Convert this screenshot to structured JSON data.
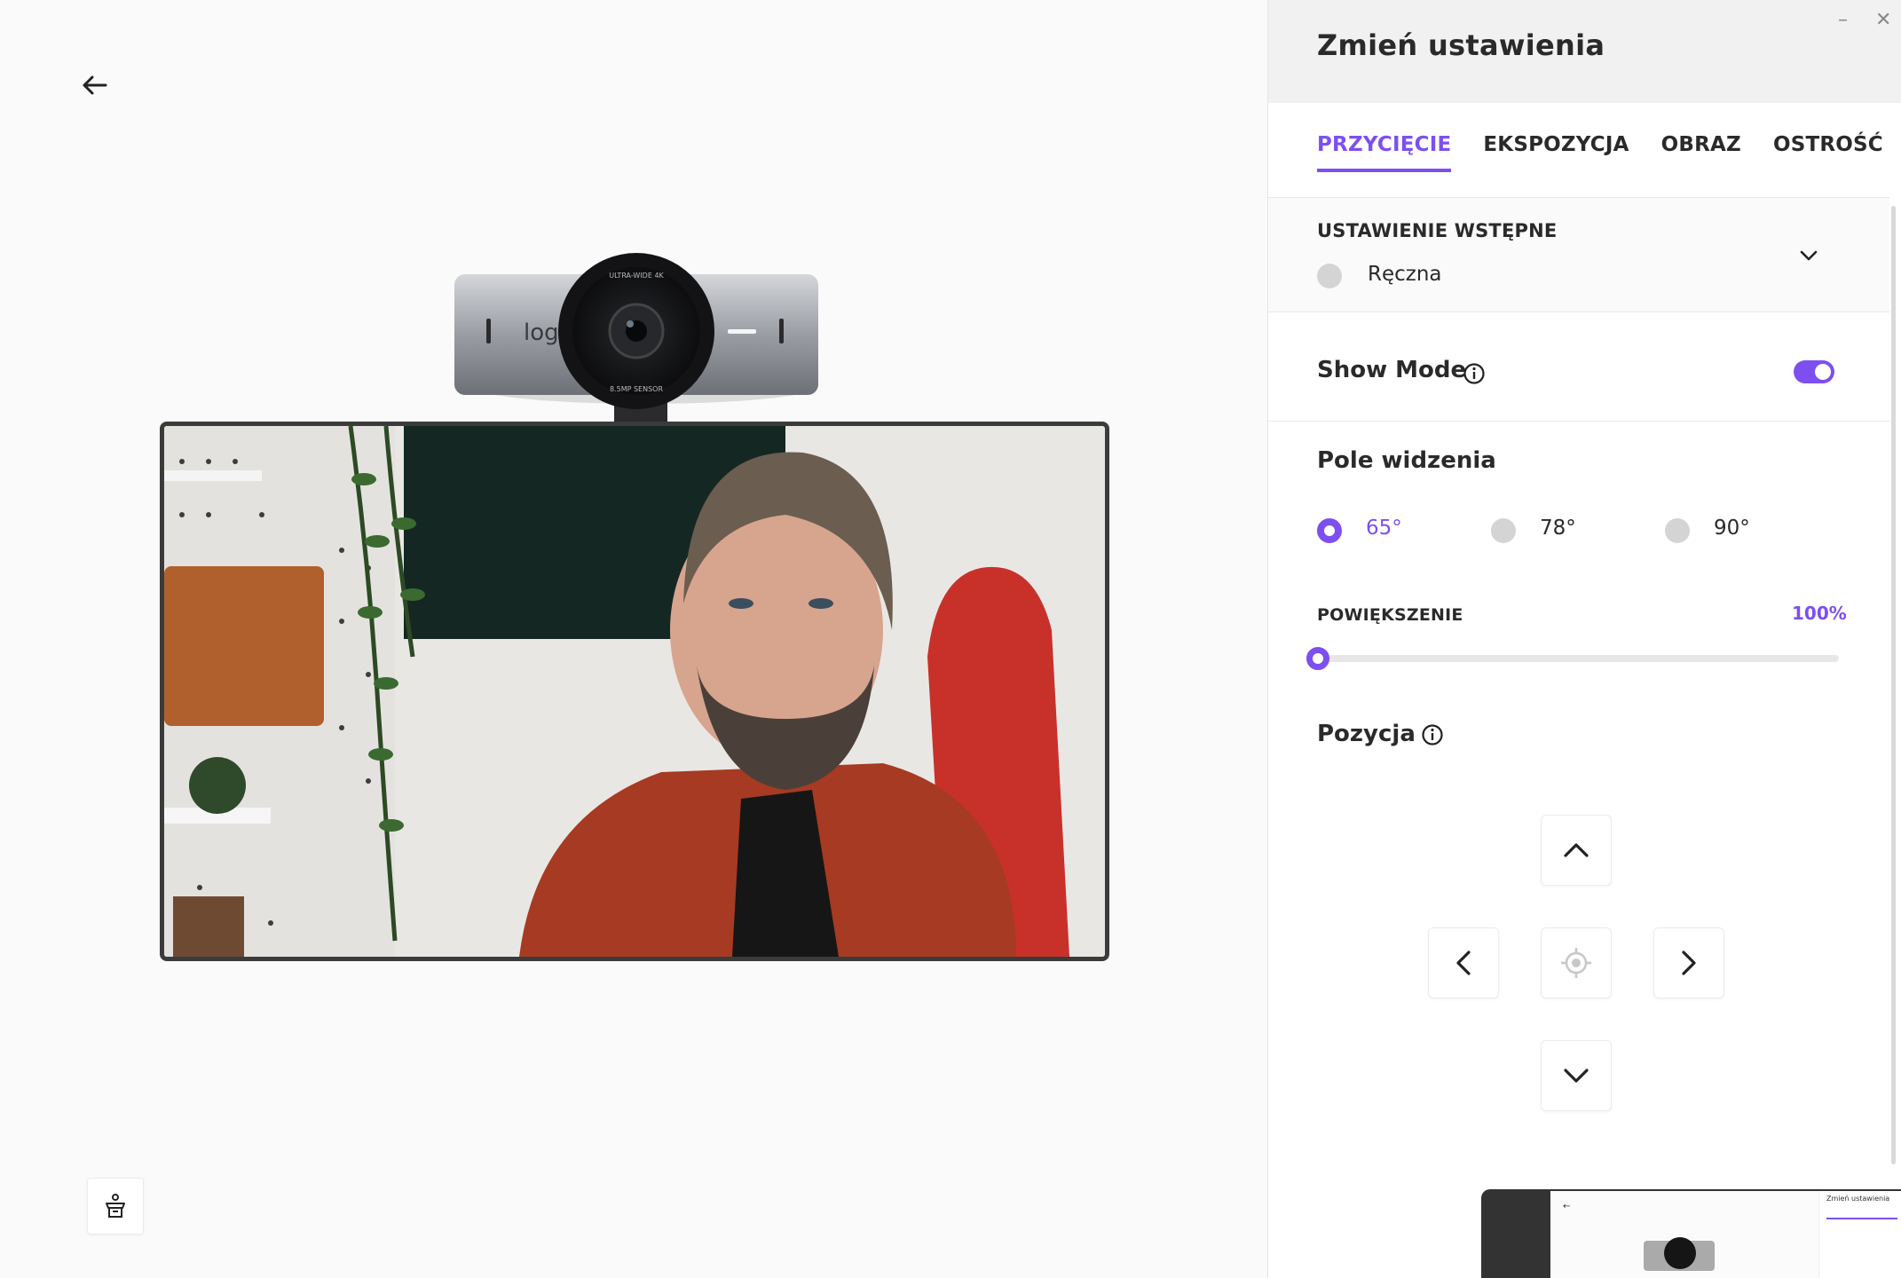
{
  "panel": {
    "title": "Zmień ustawienia",
    "minimize_label": "–",
    "close_label": "✕"
  },
  "tabs": [
    {
      "label": "PRZYCIĘCIE",
      "active": true
    },
    {
      "label": "EKSPOZYCJA",
      "active": false
    },
    {
      "label": "OBRAZ",
      "active": false
    },
    {
      "label": "OSTROŚĆ",
      "active": false
    }
  ],
  "preset": {
    "label": "USTAWIENIE WSTĘPNE",
    "value": "Ręczna"
  },
  "show_mode": {
    "label": "Show Mode",
    "enabled": true
  },
  "field_of_view": {
    "label": "Pole widzenia",
    "options": [
      {
        "label": "65°",
        "selected": true
      },
      {
        "label": "78°",
        "selected": false
      },
      {
        "label": "90°",
        "selected": false
      }
    ]
  },
  "zoom": {
    "label": "POWIĘKSZENIE",
    "value_text": "100%",
    "value": 0
  },
  "position": {
    "label": "Pozycja"
  },
  "webcam": {
    "brand": "logi",
    "lens_text_top": "ULTRA-WIDE 4K",
    "lens_text_bottom": "8.5MP SENSOR"
  },
  "thumbnail": {
    "title": "Zmień ustawienia"
  },
  "colors": {
    "accent": "#7d4ff0",
    "panel_header_bg": "#f1f1f1"
  }
}
